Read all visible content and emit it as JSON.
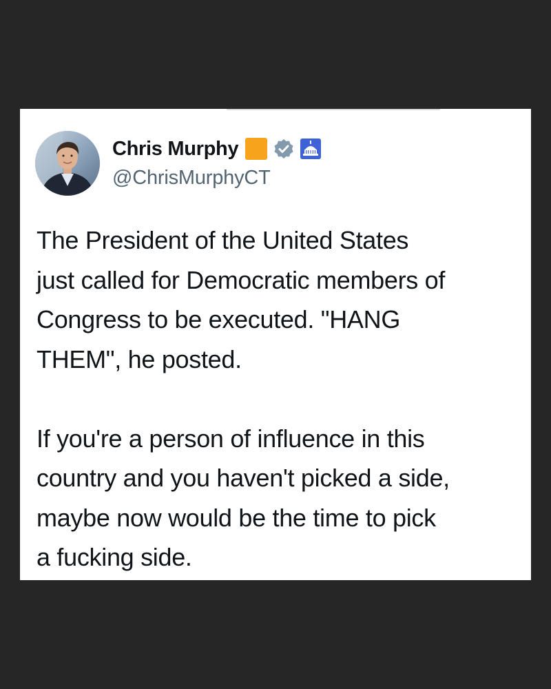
{
  "tweet": {
    "author": {
      "display_name": "Chris Murphy",
      "handle": "@ChrisMurphyCT",
      "avatar_icon": "person-avatar",
      "badges": [
        {
          "icon": "orange-square-badge",
          "color": "#f7a31c"
        },
        {
          "icon": "verified-gray-check-icon",
          "color": "#829aab"
        },
        {
          "icon": "us-government-capitol-icon",
          "color": "#3f63d6"
        }
      ]
    },
    "paragraphs": [
      "The President of the United States\njust called for Democratic members of\nCongress to be executed. \"HANG\nTHEM\", he posted.",
      "If you're a person of influence in this\ncountry and you haven't picked a side,\nmaybe now would be the time to pick\na fucking side."
    ]
  },
  "colors": {
    "background": "#262626",
    "card": "#ffffff",
    "text": "#0f1419",
    "handle": "#536471"
  }
}
